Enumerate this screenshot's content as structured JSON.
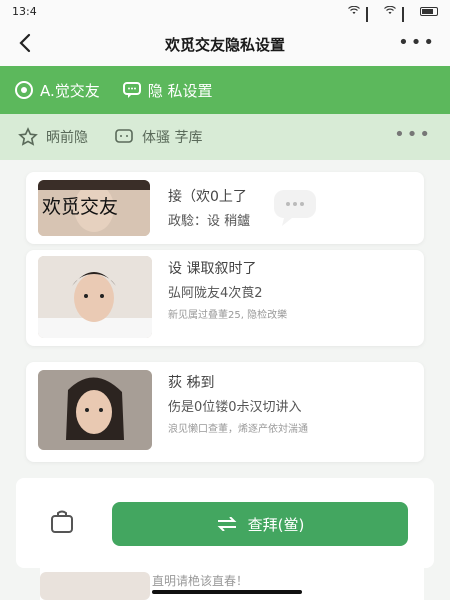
{
  "status": {
    "time": "13:4"
  },
  "nav": {
    "title": "欢觅交友隐私设置",
    "more": "•••"
  },
  "tabs": [
    {
      "label": "A.觉交友"
    },
    {
      "label": "隐 私设置"
    }
  ],
  "subtabs": [
    {
      "label": "昞前隐"
    },
    {
      "label": "体骚  芓库"
    }
  ],
  "sub_more": "•••",
  "cards": [
    {
      "overlay": "欢觅交友",
      "line1": "接（欢0上了",
      "line2": "政騐：设 稍鑪"
    },
    {
      "line1": "设 课取叙时了",
      "line2": "弘阿陇友4次莨2",
      "line3": "新见属过叠董25, 隐检改樂"
    },
    {
      "line1": "荻 秭到",
      "line2": "伤是0位镂0尗汉切讲入",
      "line3": "浪见懒口查董，烯逐产依対湍通"
    }
  ],
  "primary_button": {
    "label": "查拜(鲎)"
  },
  "last_card": {
    "text": "直明请栬该直春！"
  },
  "colors": {
    "green": "#5cb85c",
    "green_dark": "#43a660",
    "sub_bg": "#d8ebd6"
  }
}
